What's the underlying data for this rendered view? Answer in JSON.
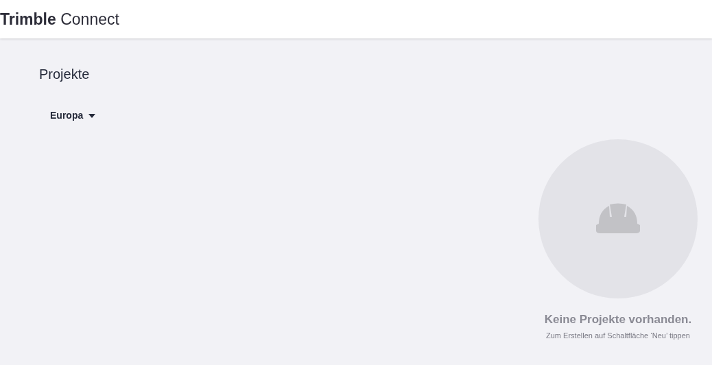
{
  "header": {
    "logo_bold": "Trimble",
    "logo_light": "Connect"
  },
  "page_title": "Projekte",
  "region_dropdown": {
    "value": "Europa"
  },
  "empty_state": {
    "title": "Keine Projekte vorhanden.",
    "hint": "Zum Erstellen auf Schaltfläche ‘Neu’ tippen"
  }
}
